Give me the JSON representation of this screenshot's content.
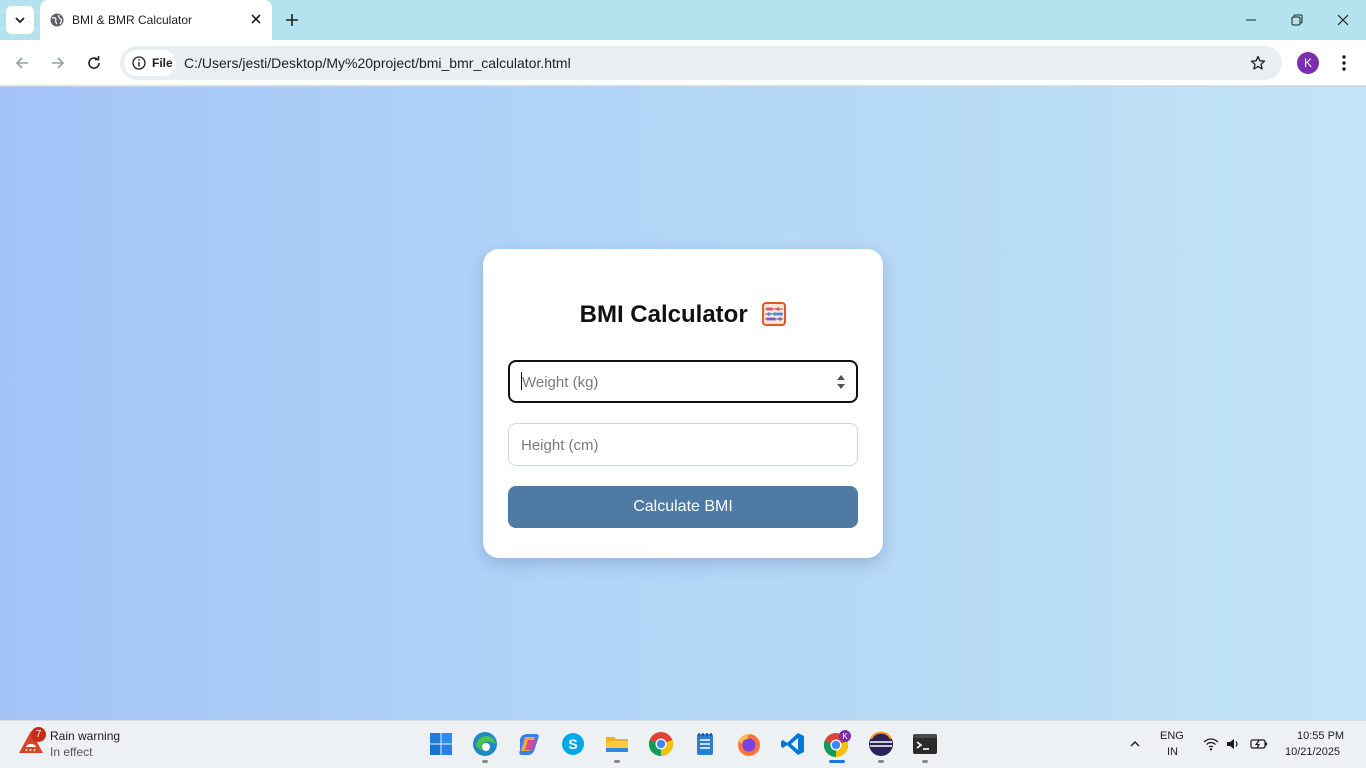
{
  "browser": {
    "tab_title": "BMI & BMR Calculator",
    "security_chip": "File",
    "url": "C:/Users/jesti/Desktop/My%20project/bmi_bmr_calculator.html",
    "profile_initial": "K"
  },
  "page": {
    "title": "BMI Calculator",
    "title_icon": "abacus-emoji",
    "weight_placeholder": "Weight (kg)",
    "weight_value": "",
    "height_placeholder": "Height (cm)",
    "height_value": "",
    "calculate_label": "Calculate BMI",
    "button_color": "#4e7aa3"
  },
  "taskbar": {
    "weather_badge": "7",
    "weather_title": "Rain warning",
    "weather_sub": "In effect",
    "apps": [
      "start-icon",
      "edge-icon",
      "copilot-icon",
      "skype-icon",
      "file-explorer-icon",
      "chrome-icon",
      "notepad-icon",
      "firefox-icon",
      "vscode-icon",
      "chrome-profile-icon",
      "eclipse-icon",
      "terminal-icon"
    ],
    "lang_top": "ENG",
    "lang_bottom": "IN",
    "time": "10:55 PM",
    "date": "10/21/2025"
  }
}
